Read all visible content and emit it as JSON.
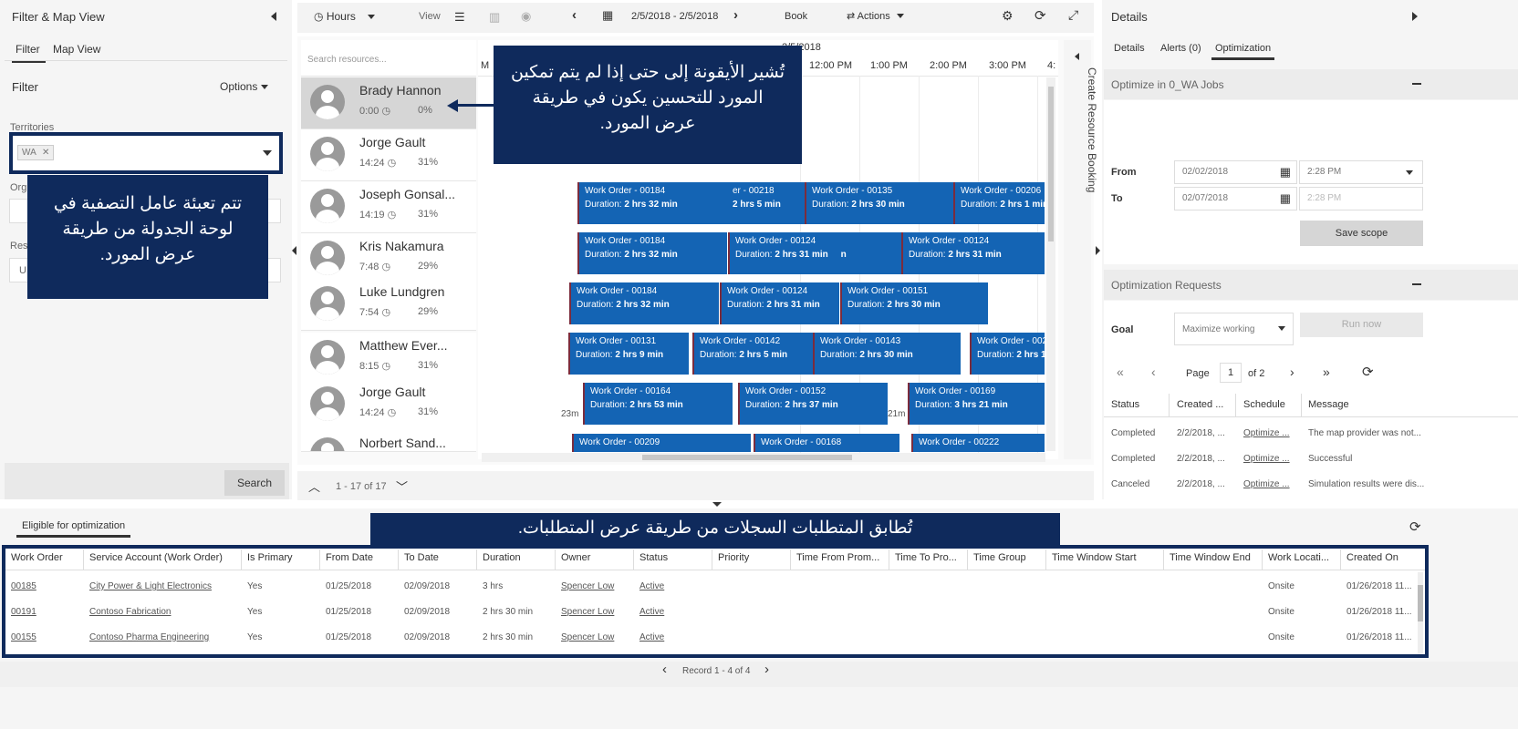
{
  "filter_panel": {
    "title": "Filter & Map View",
    "tabs": [
      "Filter",
      "Map View"
    ],
    "filter_label": "Filter",
    "options_label": "Options",
    "territories_label": "Territories",
    "territory_tag": "WA",
    "org_label": "Org",
    "res_label": "Reso",
    "res_value": "U",
    "search_button": "Search"
  },
  "toolbar": {
    "hours_label": "Hours",
    "view_label": "View",
    "date_range": "2/5/2018 - 2/5/2018",
    "book_label": "Book",
    "actions_label": "Actions"
  },
  "schedule": {
    "search_placeholder": "Search resources...",
    "date_header": "2/5/2018",
    "hours": [
      "12:00 PM",
      "1:00 PM",
      "2:00 PM",
      "3:00 PM",
      "4:"
    ],
    "partial_m": "M",
    "side_label": "Create Resource Booking",
    "pager_text": "1 - 17 of 17",
    "resources": [
      {
        "name": "Brady Hannon",
        "time": "0:00",
        "pct": "0%"
      },
      {
        "name": "Jorge Gault",
        "time": "14:24",
        "pct": "31%"
      },
      {
        "name": "Joseph Gonsal...",
        "time": "14:19",
        "pct": "31%"
      },
      {
        "name": "Kris Nakamura",
        "time": "7:48",
        "pct": "29%"
      },
      {
        "name": "Luke Lundgren",
        "time": "7:54",
        "pct": "29%"
      },
      {
        "name": "Matthew Ever...",
        "time": "8:15",
        "pct": "31%"
      },
      {
        "name": "Jorge Gault",
        "time": "14:24",
        "pct": "31%"
      },
      {
        "name": "Norbert Sand...",
        "time": "",
        "pct": ""
      }
    ],
    "bookings": {
      "r3": [
        {
          "wo": "Work Order - 00184",
          "dur": "2 hrs 32 min"
        },
        {
          "wo": "er - 00218",
          "dur": "2 hrs 5 min"
        },
        {
          "wo": "Work Order - 00135",
          "dur": "2 hrs 30 min"
        },
        {
          "wo": "Work Order - 00206",
          "dur": "2 hrs 1 min"
        }
      ],
      "r4": [
        {
          "wo": "Work Order - 00184",
          "dur": "2 hrs 32 min"
        },
        {
          "wo": "Work Order - 00124",
          "dur": "2 hrs 31 min"
        },
        {
          "wo": "Work Order - 00124",
          "dur": "2 hrs 31 min"
        }
      ],
      "r5": [
        {
          "wo": "Work Order - 00184",
          "dur": "2 hrs 32 min"
        },
        {
          "wo": "Work Order - 00124",
          "dur": "2 hrs 31 min"
        },
        {
          "wo": "Work Order - 00151",
          "dur": "2 hrs 30 min"
        }
      ],
      "r6": [
        {
          "wo": "Work Order - 00131",
          "dur": "2 hrs 9 min"
        },
        {
          "wo": "Work Order - 00142",
          "dur": "2 hrs 5 min"
        },
        {
          "wo": "Work Order - 00143",
          "dur": "2 hrs 30 min"
        },
        {
          "wo": "Work Order - 002",
          "dur": "2 hrs 1"
        }
      ],
      "r7": [
        {
          "wo": "Work Order - 00164",
          "dur": "2 hrs 53 min"
        },
        {
          "wo": "Work Order - 00152",
          "dur": "2 hrs 37 min"
        },
        {
          "wo": "Work Order - 00169",
          "dur": "3 hrs 21 min"
        }
      ],
      "r8": [
        {
          "wo": "Work Order - 00209",
          "dur": ""
        },
        {
          "wo": "Work Order - 00168",
          "dur": ""
        },
        {
          "wo": "Work Order - 00222",
          "dur": ""
        }
      ]
    },
    "duration_label": "Duration:",
    "gap_labels": [
      "23m",
      "21m"
    ],
    "stray_n": "n"
  },
  "details_panel": {
    "title": "Details",
    "tabs": [
      "Details",
      "Alerts (0)",
      "Optimization"
    ],
    "optimize_title": "Optimize in 0_WA Jobs",
    "from_label": "From",
    "to_label": "To",
    "from_date": "02/02/2018",
    "from_time": "2:28 PM",
    "to_date": "02/07/2018",
    "to_time": "2:28 PM",
    "save_scope": "Save scope",
    "requests_title": "Optimization Requests",
    "goal_label": "Goal",
    "goal_value": "Maximize working",
    "run_now": "Run now",
    "page_label": "Page",
    "page_num": "1",
    "page_of": "of 2",
    "columns": [
      "Status",
      "Created ...",
      "Schedule",
      "Message"
    ],
    "rows": [
      {
        "status": "Completed",
        "created": "2/2/2018, ...",
        "schedule": "Optimize ...",
        "message": "The map provider was not..."
      },
      {
        "status": "Completed",
        "created": "2/2/2018, ...",
        "schedule": "Optimize ...",
        "message": "Successful"
      },
      {
        "status": "Canceled",
        "created": "2/2/2018, ...",
        "schedule": "Optimize ...",
        "message": "Simulation results were dis..."
      }
    ]
  },
  "requirements": {
    "tab_label": "Eligible for optimization",
    "columns": [
      "Work Order",
      "Service Account (Work Order)",
      "Is Primary",
      "From Date",
      "To Date",
      "Duration",
      "Owner",
      "Status",
      "Priority",
      "Time From Prom...",
      "Time To Pro...",
      "Time Group",
      "Time Window Start",
      "Time Window End",
      "Work Locati...",
      "Created On"
    ],
    "rows": [
      {
        "wo": "00185",
        "account": "City Power & Light Electronics",
        "primary": "Yes",
        "from": "01/25/2018",
        "to": "02/09/2018",
        "duration": "3 hrs",
        "owner": "Spencer Low",
        "status": "Active",
        "location": "Onsite",
        "created": "01/26/2018 11..."
      },
      {
        "wo": "00191",
        "account": "Contoso Fabrication",
        "primary": "Yes",
        "from": "01/25/2018",
        "to": "02/09/2018",
        "duration": "2 hrs 30 min",
        "owner": "Spencer Low",
        "status": "Active",
        "location": "Onsite",
        "created": "01/26/2018 11..."
      },
      {
        "wo": "00155",
        "account": "Contoso Pharma Engineering",
        "primary": "Yes",
        "from": "01/25/2018",
        "to": "02/09/2018",
        "duration": "2 hrs 30 min",
        "owner": "Spencer Low",
        "status": "Active",
        "location": "Onsite",
        "created": "01/26/2018 11..."
      }
    ],
    "record_text": "Record 1 - 4 of 4"
  },
  "callouts": {
    "left": "تتم تعبئة عامل التصفية في لوحة الجدولة من طريقة عرض المورد.",
    "top": "تُشير الأيقونة إلى حتى إذا لم يتم تمكين المورد للتحسين يكون في طريقة عرض المورد.",
    "bottom": "تُطابق المتطلبات السجلات من طريقة عرض المتطلبات."
  },
  "colors": {
    "booking": "#1464b4",
    "callout": "#0f2a5c",
    "link": "#2f5fd0"
  }
}
